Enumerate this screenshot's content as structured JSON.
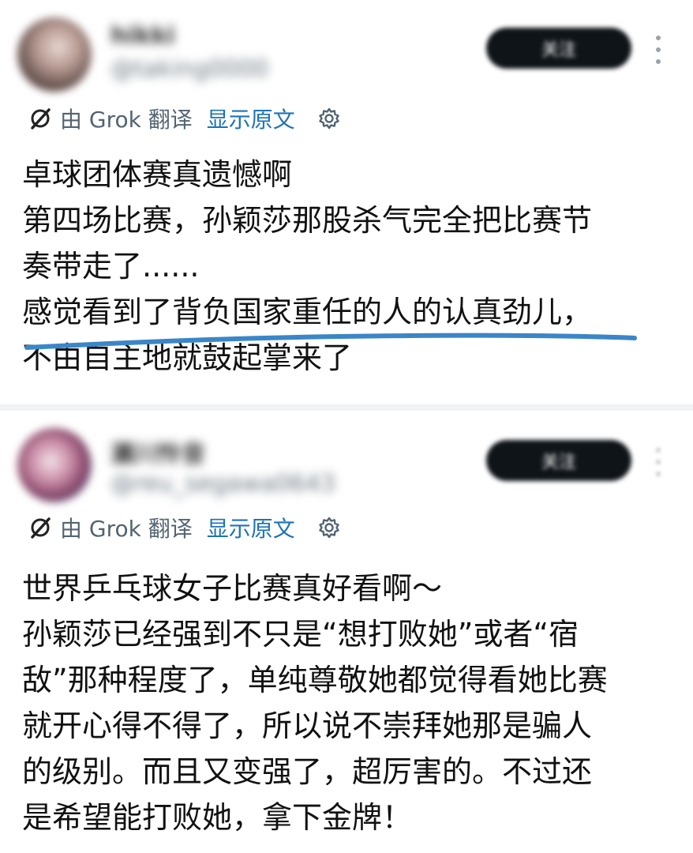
{
  "posts": [
    {
      "display_name": "hikki",
      "handle": "@taking0000",
      "follow_label": "关注",
      "translate": {
        "label": "由 Grok 翻译",
        "show_original": "显示原文"
      },
      "lines": [
        "卓球团体赛真遗憾啊",
        "第四场比赛，孙颖莎那股杀气完全把比赛节",
        "奏带走了......",
        "感觉看到了背负国家重任的人的认真劲儿，",
        "不由自主地就鼓起掌来了"
      ],
      "highlight_color": "#3a86c8"
    },
    {
      "display_name": "瀬川怜音",
      "handle": "@reu_segawa0643",
      "follow_label": "关注",
      "translate": {
        "label": "由 Grok 翻译",
        "show_original": "显示原文"
      },
      "lines": [
        "世界乒乓球女子比赛真好看啊～",
        "孙颖莎已经强到不只是“想打败她”或者“宿",
        "敌”那种程度了，单纯尊敬她都觉得看她比赛",
        "就开心得不得了，所以说不崇拜她那是骗人",
        "的级别。而且又变强了，超厉害的。不过还",
        "是希望能打败她，拿下金牌！"
      ]
    }
  ],
  "colors": {
    "link": "#1d73b8",
    "muted": "#536471",
    "button": "#0f1419"
  }
}
